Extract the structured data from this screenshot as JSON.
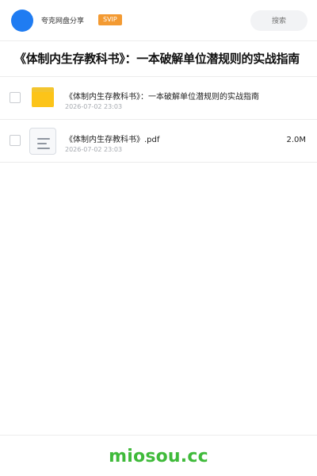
{
  "header": {
    "app_name": "夸克网盘分享",
    "badge": "SVIP",
    "search_placeholder": "搜索"
  },
  "page": {
    "title": "《体制内生存教科书》：一本破解单位潜规则的实战指南"
  },
  "files": [
    {
      "type": "folder",
      "icon": "folder-icon",
      "name": "《体制内生存教科书》：一本破解单位潜规则的实战指南",
      "date": "2026-07-02 23:03",
      "size": ""
    },
    {
      "type": "file",
      "icon": "document-icon",
      "name": "《体制内生存教科书》.pdf",
      "date": "2026-07-02 23:03",
      "size": "2.0M"
    }
  ],
  "footer": {
    "brand": "miosou.cc"
  },
  "colors": {
    "avatar": "#1f7cf2",
    "badge": "#f39a32",
    "folder": "#fcc419",
    "brand": "#3fba3a"
  }
}
